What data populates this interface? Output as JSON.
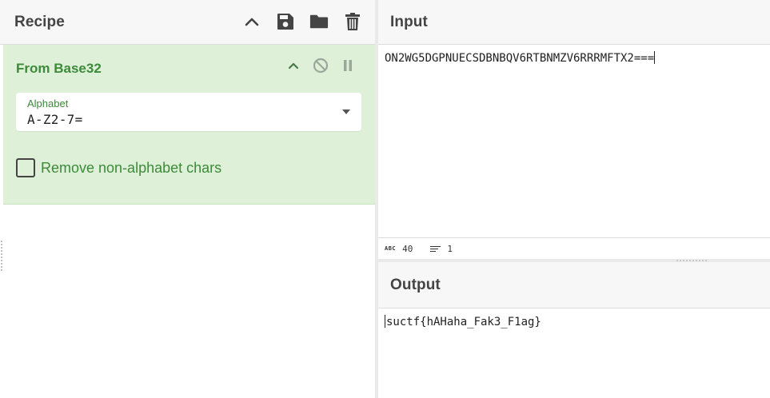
{
  "recipe": {
    "title": "Recipe",
    "icons": [
      "chevron-up-icon",
      "save-icon",
      "folder-icon",
      "trash-icon"
    ]
  },
  "operation": {
    "name": "From Base32",
    "alphabet_label": "Alphabet",
    "alphabet_value": "A-Z2-7=",
    "remove_label": "Remove non-alphabet chars",
    "remove_checked": false,
    "accent_color": "#3c8a3a",
    "background_color": "#dff0d8"
  },
  "input": {
    "title": "Input",
    "text": "ON2WG5DGPNUECSDBNBQV6RTBNMZV6RRRMFTX2===",
    "char_count": "40",
    "line_count": "1"
  },
  "output": {
    "title": "Output",
    "text": "suctf{hAHaha_Fak3_F1ag}"
  }
}
